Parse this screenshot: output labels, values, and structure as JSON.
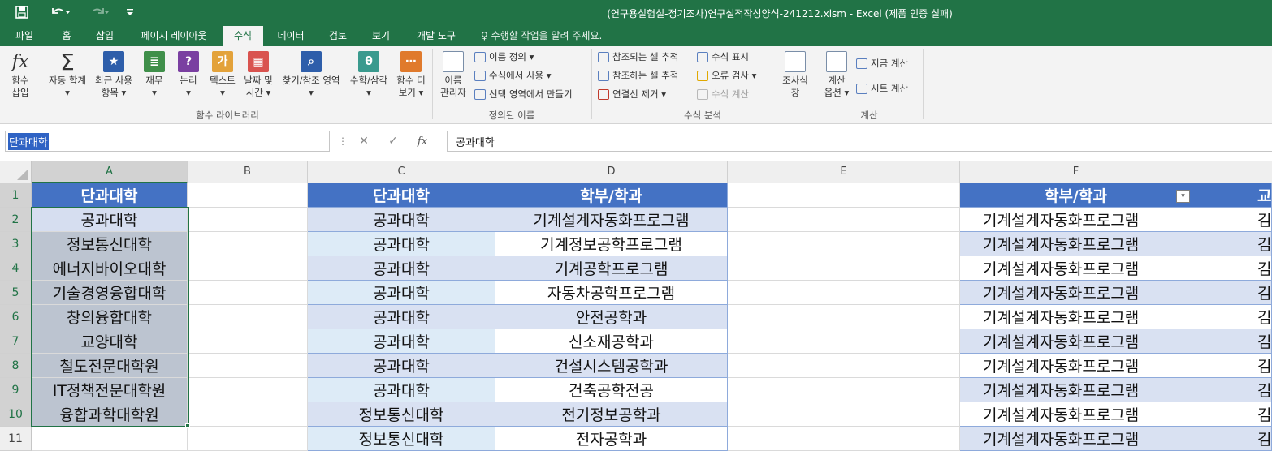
{
  "window": {
    "title": "(연구용실험실-정기조사)연구실적작성양식-241212.xlsm - Excel (제품 인증 실패)",
    "qa_icons": [
      "save-icon",
      "undo-icon",
      "redo-icon",
      "customize-icon"
    ],
    "qa_glyphs": {
      "save": "🖫",
      "undo": "↶",
      "redo": "↷",
      "customize": "⩡"
    }
  },
  "ribbon_tabs": [
    "파일",
    "홈",
    "삽입",
    "페이지 레이아웃",
    "수식",
    "데이터",
    "검토",
    "보기",
    "개발 도구"
  ],
  "active_tab": "수식",
  "tell_me": "♀ 수행할 작업을 알려 주세요.",
  "ribbon": {
    "function_library": {
      "group_label": "함수 라이브러리",
      "buttons": [
        {
          "label1": "함수",
          "label2": "삽입",
          "icon": "fx-icon",
          "glyph": "fx",
          "color": "#ffffff"
        },
        {
          "label1": "자동 합계",
          "label2": "▾",
          "icon": "sigma-icon",
          "glyph": "Σ",
          "color": "#ffffff"
        },
        {
          "label1": "최근 사용",
          "label2": "항목 ▾",
          "icon": "star-book-icon",
          "glyph": "★",
          "color": "#2e5eaa"
        },
        {
          "label1": "재무",
          "label2": "▾",
          "icon": "finance-book-icon",
          "glyph": "≣",
          "color": "#3f8f4a"
        },
        {
          "label1": "논리",
          "label2": "▾",
          "icon": "logic-book-icon",
          "glyph": "?",
          "color": "#7a3fa1"
        },
        {
          "label1": "텍스트",
          "label2": "▾",
          "icon": "text-book-icon",
          "glyph": "가",
          "color": "#e3a23a"
        },
        {
          "label1": "날짜 및",
          "label2": "시간 ▾",
          "icon": "calendar-book-icon",
          "glyph": "▦",
          "color": "#d9534f"
        },
        {
          "label1": "찾기/참조 영역",
          "label2": "▾",
          "icon": "lookup-book-icon",
          "glyph": "⌕",
          "color": "#2e5eaa"
        },
        {
          "label1": "수학/삼각",
          "label2": "▾",
          "icon": "math-book-icon",
          "glyph": "θ",
          "color": "#3a9a8e"
        },
        {
          "label1": "함수 더",
          "label2": "보기 ▾",
          "icon": "more-functions-icon",
          "glyph": "⋯",
          "color": "#e07a2c"
        }
      ]
    },
    "defined_names": {
      "group_label": "정의된 이름",
      "manager": {
        "label1": "이름",
        "label2": "관리자",
        "icon": "name-manager-icon"
      },
      "items": [
        "이름 정의 ▾",
        "수식에서 사용 ▾",
        "선택 영역에서 만들기"
      ]
    },
    "formula_auditing": {
      "group_label": "수식 분석",
      "left_items": [
        "참조되는 셀 추적",
        "참조하는 셀 추적",
        "연결선 제거 ▾"
      ],
      "right_items": [
        "수식 표시",
        "오류 검사 ▾",
        "수식 계산"
      ],
      "watch": {
        "label1": "조사식",
        "label2": "창",
        "icon": "watch-window-icon"
      }
    },
    "calculation": {
      "group_label": "계산",
      "options": {
        "label1": "계산",
        "label2": "옵션 ▾",
        "icon": "calc-options-icon"
      },
      "items": [
        "지금 계산",
        "시트 계산"
      ]
    }
  },
  "formula_bar": {
    "name_box": "단과대학",
    "buttons": [
      "⋮",
      "✕",
      "✓",
      "fx"
    ],
    "formula": "공과대학"
  },
  "sheet": {
    "columns": [
      "A",
      "B",
      "C",
      "D",
      "E",
      "F"
    ],
    "selected_column": "A",
    "rows": [
      "1",
      "2",
      "3",
      "4",
      "5",
      "6",
      "7",
      "8",
      "9",
      "10",
      "11"
    ],
    "colA": [
      "단과대학",
      "공과대학",
      "정보통신대학",
      "에너지바이오대학",
      "기술경영융합대학",
      "창의융합대학",
      "교양대학",
      "철도전문대학원",
      "IT정책전문대학원",
      "융합과학대학원",
      ""
    ],
    "colC": [
      "단과대학",
      "공과대학",
      "공과대학",
      "공과대학",
      "공과대학",
      "공과대학",
      "공과대학",
      "공과대학",
      "공과대학",
      "정보통신대학",
      "정보통신대학"
    ],
    "colD": [
      "학부/학과",
      "기계설계자동화프로그램",
      "기계정보공학프로그램",
      "기계공학프로그램",
      "자동차공학프로그램",
      "안전공학과",
      "신소재공학과",
      "건설시스템공학과",
      "건축공학전공",
      "전기정보공학과",
      "전자공학과"
    ],
    "colF": [
      "학부/학과",
      "기계설계자동화프로그램",
      "기계설계자동화프로그램",
      "기계설계자동화프로그램",
      "기계설계자동화프로그램",
      "기계설계자동화프로그램",
      "기계설계자동화프로그램",
      "기계설계자동화프로그램",
      "기계설계자동화프로그램",
      "기계설계자동화프로그램",
      "기계설계자동화프로그램"
    ],
    "colG": [
      "교",
      "김",
      "김",
      "김",
      "김",
      "김",
      "김",
      "김",
      "김",
      "김",
      "김"
    ],
    "filter_icon": "▾"
  }
}
